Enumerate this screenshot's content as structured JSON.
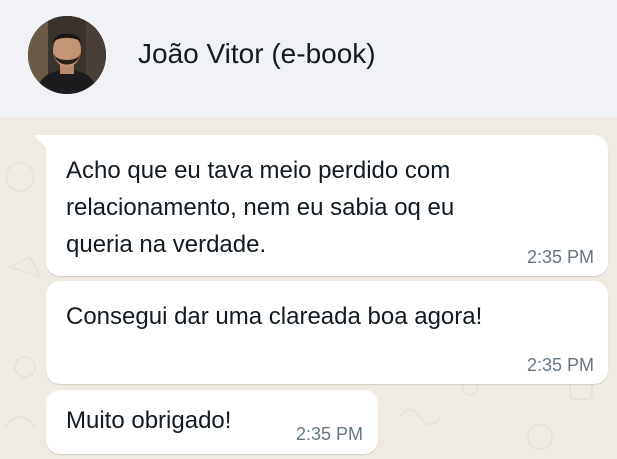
{
  "header": {
    "contact_name": "João Vitor (e-book)",
    "avatar": "contact-avatar-photo"
  },
  "theme": {
    "header_bg": "#f0f2f5",
    "chat_bg": "#efeae2",
    "bubble_bg": "#ffffff",
    "time_color": "#667781"
  },
  "messages": [
    {
      "lines": [
        "Acho que eu tava meio perdido com",
        "relacionamento, nem eu sabia oq eu",
        "queria na verdade."
      ],
      "time": "2:35 PM"
    },
    {
      "lines": [
        "Consegui dar uma clareada boa agora!"
      ],
      "time": "2:35 PM"
    },
    {
      "lines": [
        "Muito obrigado!"
      ],
      "time": "2:35 PM"
    }
  ]
}
